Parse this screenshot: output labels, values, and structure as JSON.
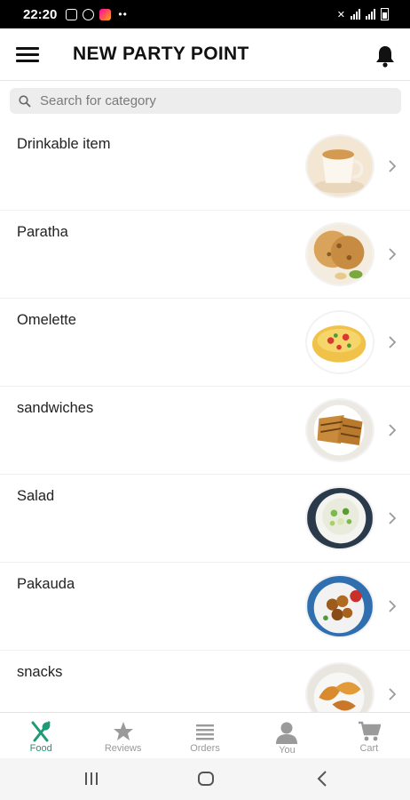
{
  "status_bar": {
    "time": "22:20"
  },
  "app_bar": {
    "title": "NEW PARTY POINT"
  },
  "search": {
    "placeholder": "Search for category"
  },
  "categories": [
    {
      "label": "Drinkable item",
      "icon": "tea-cup-image"
    },
    {
      "label": "Paratha",
      "icon": "paratha-image"
    },
    {
      "label": "Omelette",
      "icon": "omelette-image"
    },
    {
      "label": "sandwiches",
      "icon": "sandwich-image"
    },
    {
      "label": "Salad",
      "icon": "salad-image"
    },
    {
      "label": "Pakauda",
      "icon": "pakauda-image"
    },
    {
      "label": "snacks",
      "icon": "snacks-image"
    }
  ],
  "bottom_nav": {
    "items": [
      {
        "label": "Food",
        "icon": "fork-spoon-icon",
        "active": true
      },
      {
        "label": "Reviews",
        "icon": "star-icon",
        "active": false
      },
      {
        "label": "Orders",
        "icon": "list-icon",
        "active": false
      },
      {
        "label": "You",
        "icon": "person-icon",
        "active": false
      },
      {
        "label": "Cart",
        "icon": "cart-icon",
        "active": false
      }
    ]
  },
  "colors": {
    "accent": "#1d9a77",
    "inactive": "#9a9a9a"
  }
}
